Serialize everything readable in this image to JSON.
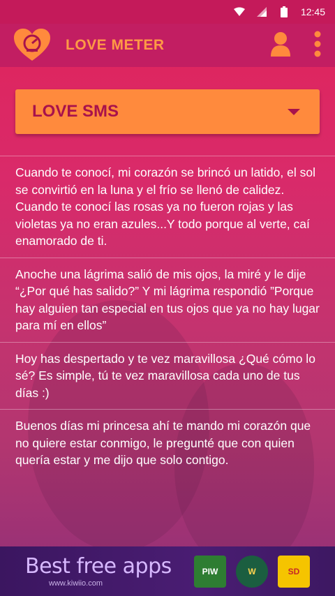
{
  "status_bar": {
    "time": "12:45"
  },
  "app_bar": {
    "title": "LOVE METER"
  },
  "category_dropdown": {
    "selected": "LOVE SMS"
  },
  "messages": [
    {
      "text": "Cuando te conocí, mi corazón se brincó un latido, el sol se convirtió en la luna y el frío se llenó de calidez. Cuando te conocí las rosas ya no fueron rojas y las violetas ya no eran azules...Y todo porque al verte, caí enamorado de ti."
    },
    {
      "text": "Anoche una lágrima salió de mis ojos, la miré y le dije “¿Por qué has salido?” Y mi lágrima respondió ”Porque hay alguien tan especial en tus ojos que ya no hay lugar para mí en ellos”"
    },
    {
      "text": "Hoy has despertado y te vez maravillosa ¿Qué cómo lo sé? Es simple, tú te vez maravillosa cada uno de tus días :)"
    },
    {
      "text": "Buenos días mi princesa ahí te mando mi corazón que no quiere estar conmigo, le pregunté que con quien quería estar y me dijo que solo contigo."
    }
  ],
  "ad_banner": {
    "headline": "Best free apps",
    "url": "www.kiwiio.com",
    "apps": [
      {
        "label": "PIW",
        "color": "#2e7d32"
      },
      {
        "label": "W",
        "color": "#1b5e40"
      },
      {
        "label": "SD",
        "color": "#f5c400"
      }
    ]
  },
  "colors": {
    "accent": "#ff8a3d",
    "app_bar": "#c21e62",
    "dropdown_text": "#a8124c"
  },
  "icons": [
    "wifi-icon",
    "signal-icon",
    "battery-icon",
    "heart-meter-logo-icon",
    "user-icon",
    "more-vert-icon",
    "dropdown-arrow-icon"
  ]
}
